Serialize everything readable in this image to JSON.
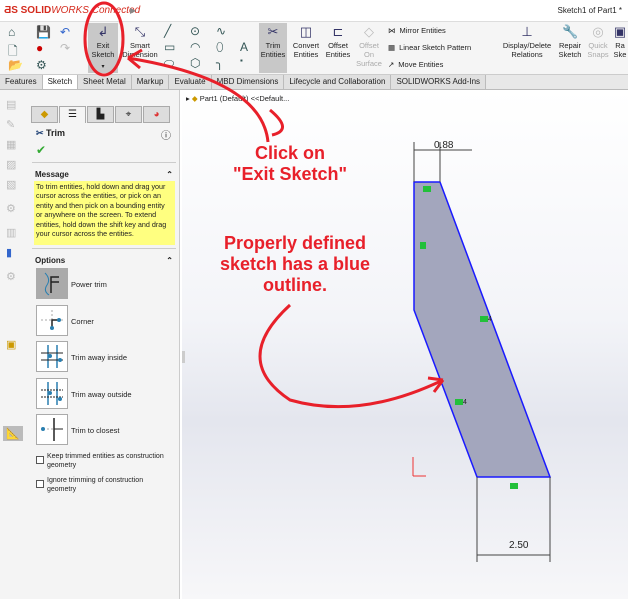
{
  "title_bar": {
    "app_name_prefix": "SOLID",
    "app_name_suffix": "WORKS Connected",
    "doc_title": "Sketch1 of Part1 *"
  },
  "ribbon": {
    "exit_sketch": "Exit Sketch",
    "smart_dimension": "Smart Dimension",
    "trim_entities": "Trim Entities",
    "convert_entities": "Convert Entities",
    "offset_entities": "Offset Entities",
    "offset_on_surface": "Offset On Surface",
    "mirror_entities": "Mirror Entities",
    "linear_sketch_pattern": "Linear Sketch Pattern",
    "move_entities": "Move Entities",
    "display_delete_relations": "Display/Delete Relations",
    "repair_sketch": "Repair Sketch",
    "quick_snaps": "Quick Snaps",
    "rapid_sketch": "Ra Ske"
  },
  "tabs": [
    "Features",
    "Sketch",
    "Sheet Metal",
    "Markup",
    "Evaluate",
    "MBD Dimensions",
    "Lifecycle and Collaboration",
    "SOLIDWORKS Add-Ins"
  ],
  "property_manager": {
    "title": "Trim",
    "message_header": "Message",
    "message": "To trim entities, hold down and drag your cursor across the entities, or pick on an entity and then pick on a bounding entity or anywhere on the screen.  To extend entities, hold down the shift key and drag your cursor across the entities.",
    "options_header": "Options",
    "options": [
      "Power trim",
      "Corner",
      "Trim away inside",
      "Trim away outside",
      "Trim to closest"
    ],
    "selected_option": "Power trim",
    "checkboxes": [
      {
        "label": "Keep trimmed entities as construction geometry",
        "checked": false
      },
      {
        "label": "Ignore trimming of construction geometry",
        "checked": false
      }
    ]
  },
  "graphics": {
    "tree_item": "Part1 (Default) <<Default...",
    "dim_top": "0.88",
    "dim_bottom": "2.50",
    "outline_color": "#1a1aff",
    "fill_color": "#a3a6bd",
    "relation_count": "4"
  },
  "annotations": {
    "callout1_line1": "Click on",
    "callout1_line2": "\"Exit Sketch\"",
    "callout2_line1": "Properly defined",
    "callout2_line2": "sketch has a blue",
    "callout2_line3": "outline.",
    "color": "#e8202a"
  }
}
